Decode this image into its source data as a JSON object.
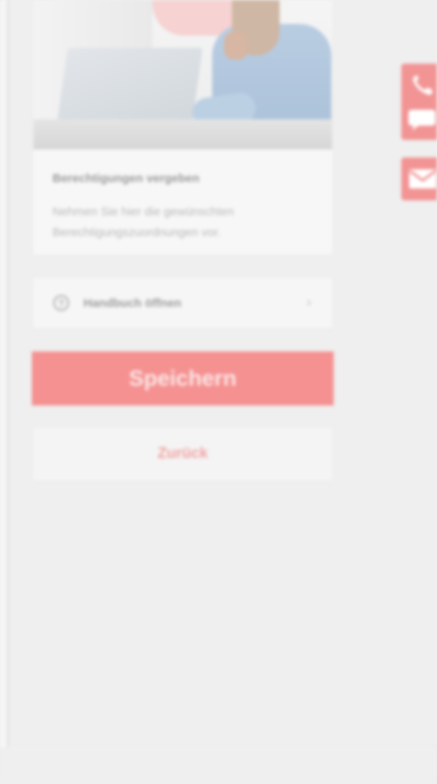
{
  "card": {
    "title": "Berechtigungen vergeben",
    "description": "Nehmen Sie hier die gewünschten Berechtigungszuordnungen vor."
  },
  "manual": {
    "label": "Handbuch öffnen",
    "icon": "help-circle-icon",
    "chevron": "chevron-right-icon"
  },
  "actions": {
    "save_label": "Speichern",
    "back_label": "Zurück"
  },
  "side_contact": {
    "icons": [
      "phone-icon",
      "chat-icon",
      "mail-icon"
    ]
  },
  "colors": {
    "accent": "#f29494",
    "background": "#efefef"
  }
}
